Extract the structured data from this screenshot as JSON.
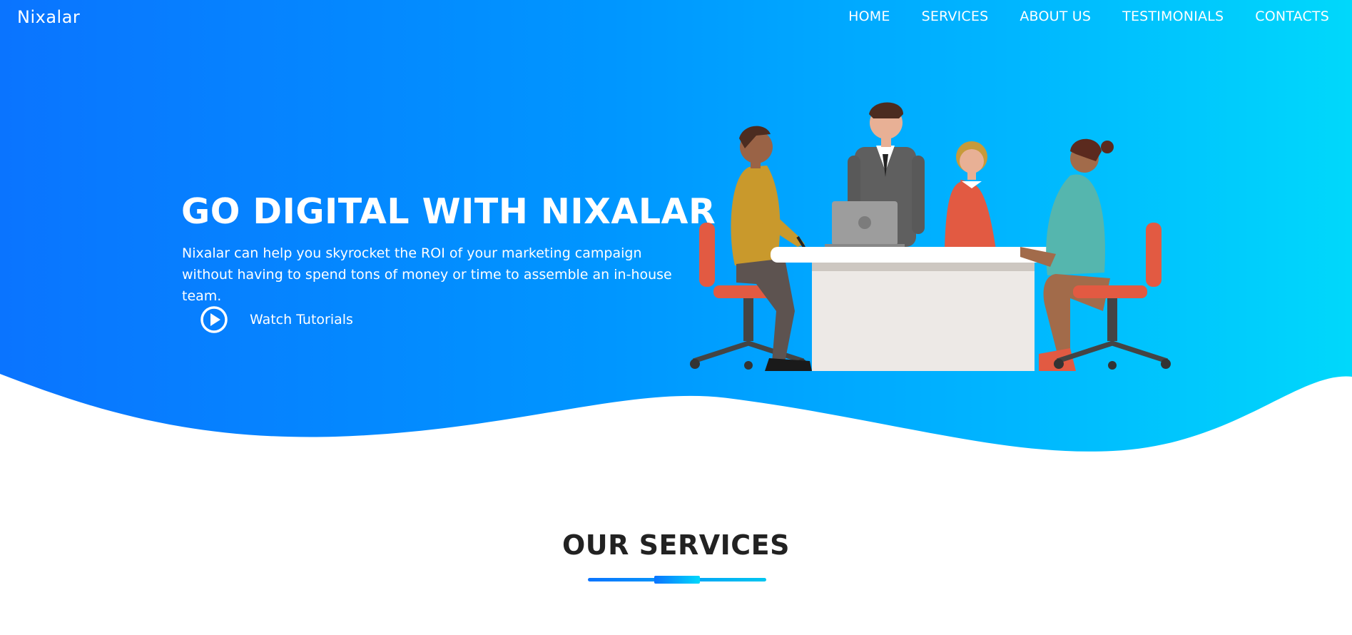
{
  "brand": {
    "name": "Nixalar"
  },
  "nav": {
    "items": [
      {
        "label": "HOME"
      },
      {
        "label": "SERVICES"
      },
      {
        "label": "ABOUT US"
      },
      {
        "label": "TESTIMONIALS"
      },
      {
        "label": "CONTACTS"
      }
    ]
  },
  "hero": {
    "title": "GO DIGITAL WITH NIXALAR",
    "subtitle": "Nixalar can help you skyrocket the ROI of your marketing campaign without having to spend tons of money or time to assemble an in-house team.",
    "cta_label": "Watch Tutorials",
    "cta_icon": "play-circle-icon",
    "illustration": "team-meeting-illustration"
  },
  "services": {
    "title": "OUR SERVICES"
  },
  "colors": {
    "gradient_start": "#0a74ff",
    "gradient_end": "#00d8fb",
    "text_on_hero": "#ffffff",
    "heading_dark": "#222222"
  }
}
